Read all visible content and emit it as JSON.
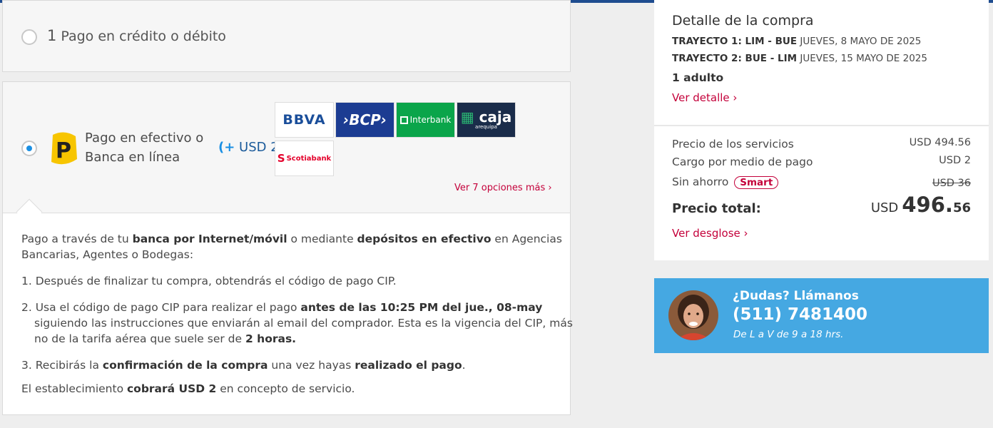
{
  "payment": {
    "option1": {
      "number": "1",
      "label": "Pago en crédito o débito"
    },
    "option2": {
      "line1": "Pago en efectivo o",
      "line2": "Banca en línea",
      "fee_plus": "(+",
      "fee_amount": "USD 2)",
      "logo_letter": "P",
      "banks": {
        "bbva": "BBVA",
        "bcp": "›BCP›",
        "interbank": "Interbank",
        "caja": "caja",
        "caja_sub": "arequipa",
        "scotiabank": "Scotiabank"
      },
      "more_link": "Ver 7 opciones más ›"
    },
    "details": {
      "intro_1": "Pago a través de tu ",
      "intro_bold_1": "banca por Internet/móvil",
      "intro_2": " o mediante ",
      "intro_bold_2": "depósitos en efectivo",
      "intro_3": " en Agencias",
      "intro_line2": "Bancarias, Agentes o Bodegas:",
      "step1": "1. Después de finalizar tu compra, obtendrás el código de pago CIP.",
      "step2_a": "2. Usa el código de pago CIP para realizar el pago ",
      "step2_bold": "antes de las 10:25 PM del jue., 08-may",
      "step2_line2": "siguiendo las instrucciones que enviarán al email del comprador. Esta es la vigencia del CIP, más",
      "step2_line3_a": "no de la tarifa aérea que suele ser de ",
      "step2_line3_bold": "2 horas.",
      "step3_a": "3. Recibirás la ",
      "step3_bold1": "confirmación de la compra",
      "step3_b": " una vez hayas ",
      "step3_bold2": "realizado el pago",
      "step3_c": ".",
      "footer_a": "El establecimiento ",
      "footer_bold": "cobrará USD 2",
      "footer_b": " en concepto de servicio."
    }
  },
  "summary": {
    "title": "Detalle de la compra",
    "leg1_label": "TRAYECTO 1: LIM - BUE",
    "leg1_date": " JUEVES, 8 MAYO DE 2025",
    "leg2_label": "TRAYECTO 2: BUE - LIM",
    "leg2_date": " JUEVES, 15 MAYO DE 2025",
    "passengers": "1 adulto",
    "detail_link": "Ver detalle ›",
    "services_label": "Precio de los servicios",
    "services_value": "USD 494.56",
    "fee_label": "Cargo por medio de pago",
    "fee_value": "USD 2",
    "nosave_label": "Sin ahorro",
    "smart_badge": "Smart",
    "nosave_value": "USD  36",
    "total_label": "Precio total:",
    "total_currency": "USD",
    "total_int": "496.",
    "total_dec": "56",
    "breakdown_link": "Ver desglose ›"
  },
  "help": {
    "title": "¿Dudas? Llámanos",
    "phone": "(511) 7481400",
    "hours": "De L a V de 9 a 18 hrs."
  }
}
